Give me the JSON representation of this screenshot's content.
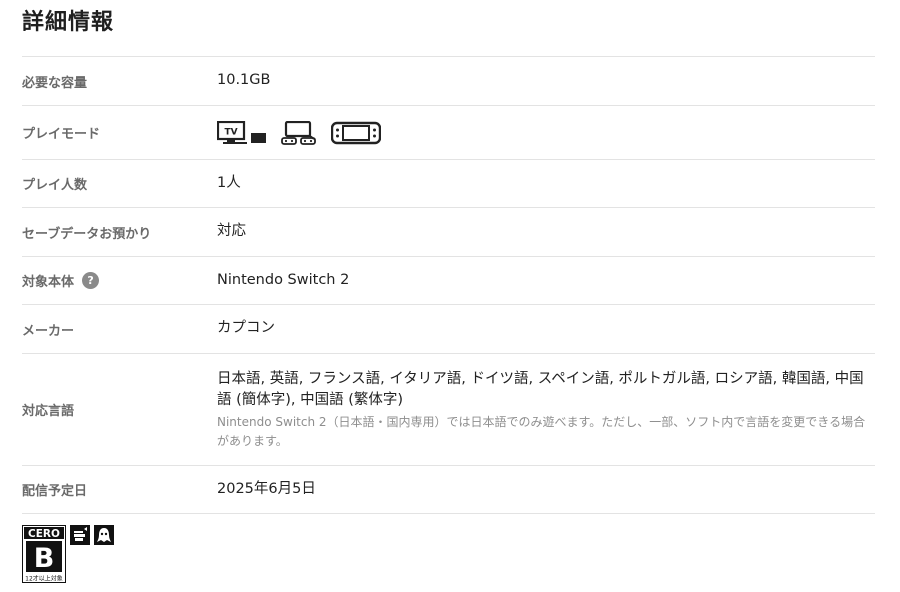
{
  "section_title": "詳細情報",
  "rows": [
    {
      "label": "必要な容量",
      "value": "10.1GB"
    },
    {
      "label": "プレイモード",
      "modes": [
        "tv-mode-icon",
        "tabletop-mode-icon",
        "handheld-mode-icon"
      ]
    },
    {
      "label": "プレイ人数",
      "value": "1人"
    },
    {
      "label": "セーブデータお預かり",
      "value": "対応"
    },
    {
      "label": "対象本体",
      "help": "?",
      "value": "Nintendo Switch 2"
    },
    {
      "label": "メーカー",
      "value": "カプコン"
    },
    {
      "label": "対応言語",
      "value": "日本語, 英語, フランス語, イタリア語, ドイツ語, スペイン語, ポルトガル語, ロシア語, 韓国語, 中国語 (簡体字), 中国語 (繁体字)",
      "note": "Nintendo Switch 2（日本語・国内専用）では日本語でのみ遊べます。ただし、一部、ソフト内で言語を変更できる場合があります。"
    },
    {
      "label": "配信予定日",
      "value": "2025年6月5日"
    }
  ],
  "rating": {
    "cero_brand": "CERO",
    "cero_class": "B",
    "cero_age": "12才以上対象",
    "descriptors": [
      "violence-icon",
      "horror-icon"
    ]
  },
  "colors": {
    "label": "#6a6a6a",
    "divider": "#e3e3e3",
    "note": "#8e8e8e"
  }
}
